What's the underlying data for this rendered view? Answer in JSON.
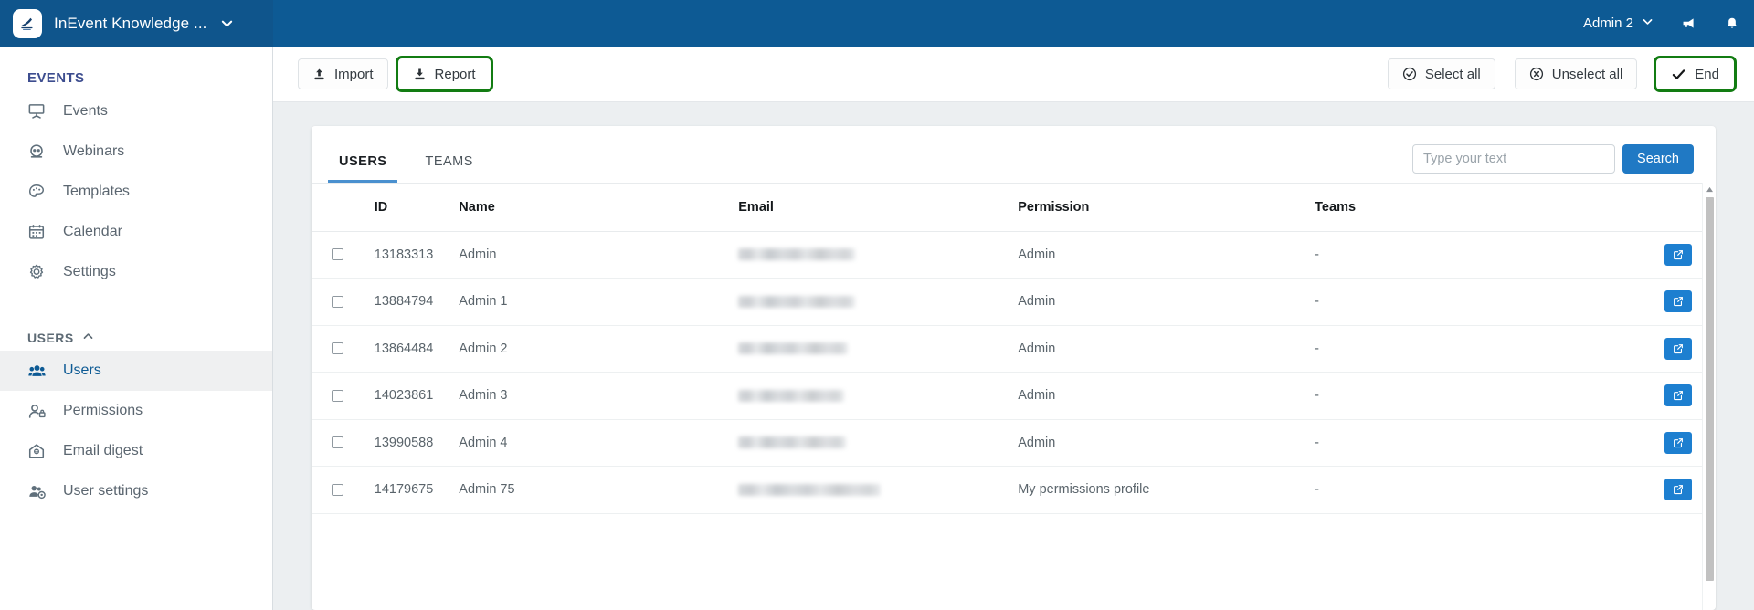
{
  "topbar": {
    "brand_name": "InEvent Knowledge ...",
    "brand_caret_icon": "chevron-down-icon",
    "logo_icon": "inevent-logo",
    "account_label": "Admin 2",
    "account_caret_icon": "chevron-down-icon",
    "announcements_icon": "megaphone-icon",
    "notifications_icon": "bell-icon",
    "background_color": "#0d5a94"
  },
  "sidebar": {
    "events_section_title": "EVENTS",
    "events_items": [
      {
        "label": "Events",
        "icon": "projector-screen-icon"
      },
      {
        "label": "Webinars",
        "icon": "webcam-icon"
      },
      {
        "label": "Templates",
        "icon": "palette-icon"
      },
      {
        "label": "Calendar",
        "icon": "calendar-icon"
      },
      {
        "label": "Settings",
        "icon": "gear-icon"
      }
    ],
    "users_section_title": "USERS",
    "users_section_collapse_icon": "chevron-up-icon",
    "users_items": [
      {
        "label": "Users",
        "icon": "users-group-icon",
        "active": true
      },
      {
        "label": "Permissions",
        "icon": "user-lock-icon",
        "active": false
      },
      {
        "label": "Email digest",
        "icon": "email-open-icon",
        "active": false
      },
      {
        "label": "User settings",
        "icon": "users-gear-icon",
        "active": false
      }
    ],
    "active_item_color": "#0d5a94"
  },
  "toolbar": {
    "left_buttons": [
      {
        "label": "Import",
        "icon": "upload-icon",
        "highlighted": false
      },
      {
        "label": "Report",
        "icon": "download-icon",
        "highlighted": true
      }
    ],
    "right_buttons": [
      {
        "label": "Select all",
        "icon": "check-circle-icon",
        "highlighted": false
      },
      {
        "label": "Unselect all",
        "icon": "x-circle-icon",
        "highlighted": false
      },
      {
        "label": "End",
        "icon": "check-icon",
        "highlighted": true
      }
    ],
    "highlight_color": "#127c12"
  },
  "main": {
    "tabs": [
      {
        "label": "USERS",
        "active": true
      },
      {
        "label": "TEAMS",
        "active": false
      }
    ],
    "search": {
      "placeholder": "Type your text",
      "value": "",
      "button_label": "Search",
      "button_color": "#2079c4"
    },
    "table": {
      "columns": [
        "",
        "ID",
        "Name",
        "Email",
        "Permission",
        "Teams",
        ""
      ],
      "rows": [
        {
          "checked": false,
          "id": "13183313",
          "name": "Admin",
          "email": "",
          "email_redacted": true,
          "permission": "Admin",
          "teams": "-",
          "action_icon": "edit-external-icon"
        },
        {
          "checked": false,
          "id": "13884794",
          "name": "Admin 1",
          "email": "",
          "email_redacted": true,
          "permission": "Admin",
          "teams": "-",
          "action_icon": "edit-external-icon"
        },
        {
          "checked": false,
          "id": "13864484",
          "name": "Admin 2",
          "email": "",
          "email_redacted": true,
          "permission": "Admin",
          "teams": "-",
          "action_icon": "edit-external-icon"
        },
        {
          "checked": false,
          "id": "14023861",
          "name": "Admin 3",
          "email": "",
          "email_redacted": true,
          "permission": "Admin",
          "teams": "-",
          "action_icon": "edit-external-icon"
        },
        {
          "checked": false,
          "id": "13990588",
          "name": "Admin 4",
          "email": "",
          "email_redacted": true,
          "permission": "Admin",
          "teams": "-",
          "action_icon": "edit-external-icon"
        },
        {
          "checked": false,
          "id": "14179675",
          "name": "Admin 75",
          "email": "",
          "email_redacted": true,
          "permission": "My permissions profile",
          "teams": "-",
          "action_icon": "edit-external-icon"
        }
      ],
      "email_blur_widths": [
        128,
        128,
        120,
        116,
        118,
        156
      ]
    },
    "scrollbar": {
      "up_arrow_icon": "triangle-up-icon"
    }
  }
}
